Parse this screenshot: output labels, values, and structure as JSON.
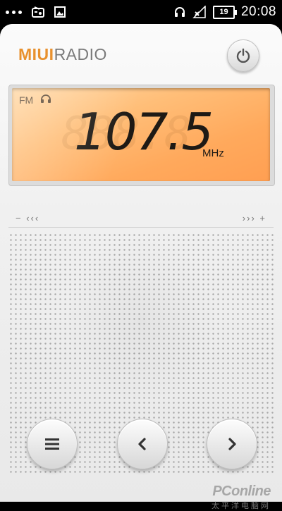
{
  "status_bar": {
    "battery": "19",
    "time": "20:08"
  },
  "app": {
    "brand_miui": "MIUI",
    "brand_radio": "RADIO"
  },
  "display": {
    "band": "FM",
    "frequency": "107.5",
    "unit": "MHz",
    "ghost_digits": "888.8"
  },
  "tuner": {
    "left": "− ‹‹‹",
    "right": "››› +"
  },
  "watermark": {
    "logo": "PConline",
    "sub": "太平洋电脑网"
  },
  "colors": {
    "accent": "#e8912e",
    "lcd": "#ffb066"
  }
}
